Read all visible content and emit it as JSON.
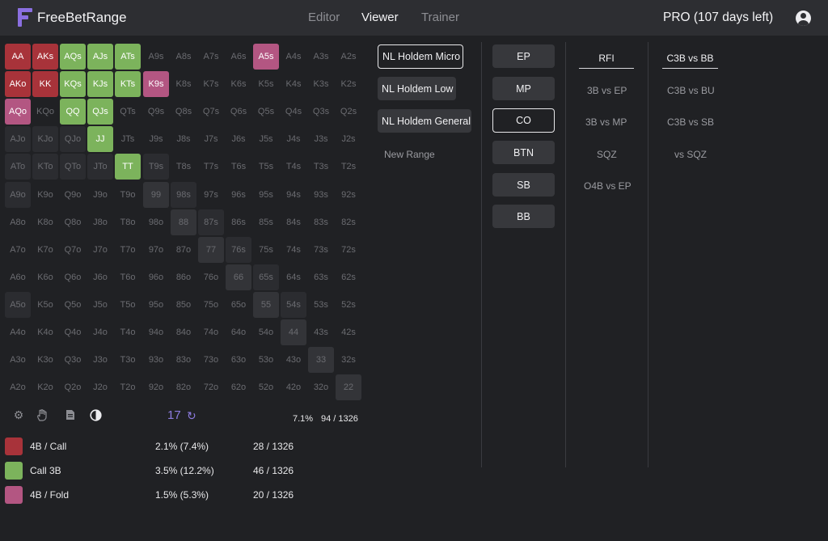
{
  "app": {
    "logo_text": "FreeBetRange",
    "nav": [
      "Editor",
      "Viewer",
      "Trainer"
    ],
    "active_nav": "Viewer",
    "subscription": "PRO (107 days left)"
  },
  "colors": {
    "red": "#a8333a",
    "green": "#7cb35c",
    "pink": "#b35682",
    "accent": "#8d7ce0"
  },
  "grid": {
    "ranks": [
      "A",
      "K",
      "Q",
      "J",
      "T",
      "9",
      "8",
      "7",
      "6",
      "5",
      "4",
      "3",
      "2"
    ],
    "highlighted": {
      "AA": "red",
      "AKs": "red",
      "AKo": "red",
      "KK": "red",
      "AQs": "green",
      "AJs": "green",
      "ATs": "green",
      "KQs": "green",
      "KJs": "green",
      "KTs": "green",
      "QQ": "green",
      "QJs": "green",
      "JJ": "green",
      "TT": "green",
      "A5s": "pink",
      "K9s": "pink",
      "AQo": "pink"
    },
    "shaded": [
      "AJo",
      "KJo",
      "QJo",
      "ATo",
      "KTo",
      "QTo",
      "JTo",
      "A9o",
      "T9s",
      "98s",
      "87s",
      "76s",
      "65s",
      "54s",
      "A5o"
    ]
  },
  "toolbar": {
    "icons": [
      "gear-icon",
      "hand-icon",
      "document-icon",
      "contrast-icon"
    ],
    "combo_count": "17",
    "refresh_icon": "↻",
    "range_pct": "7.1%",
    "range_combos": "94 / 1326"
  },
  "legend": [
    {
      "label": "4B / Call",
      "pct": "2.1% (7.4%)",
      "combos": "28 / 1326",
      "color": "red"
    },
    {
      "label": "Call 3B",
      "pct": "3.5% (12.2%)",
      "combos": "46 / 1326",
      "color": "green"
    },
    {
      "label": "4B / Fold",
      "pct": "1.5% (5.3%)",
      "combos": "20 / 1326",
      "color": "pink"
    }
  ],
  "range_sets": {
    "items": [
      "NL Holdem Micro",
      "NL Holdem Low",
      "NL Holdem General"
    ],
    "selected": "NL Holdem Micro",
    "new_label": "New Range"
  },
  "positions": {
    "items": [
      "EP",
      "MP",
      "CO",
      "BTN",
      "SB",
      "BB"
    ],
    "selected": "CO"
  },
  "situations": {
    "active": "RFI",
    "items": [
      "3B vs EP",
      "3B vs MP",
      "SQZ",
      "O4B vs EP"
    ]
  },
  "actions": {
    "active": "C3B vs BB",
    "items": [
      "C3B vs BU",
      "C3B vs SB",
      "vs SQZ"
    ]
  }
}
